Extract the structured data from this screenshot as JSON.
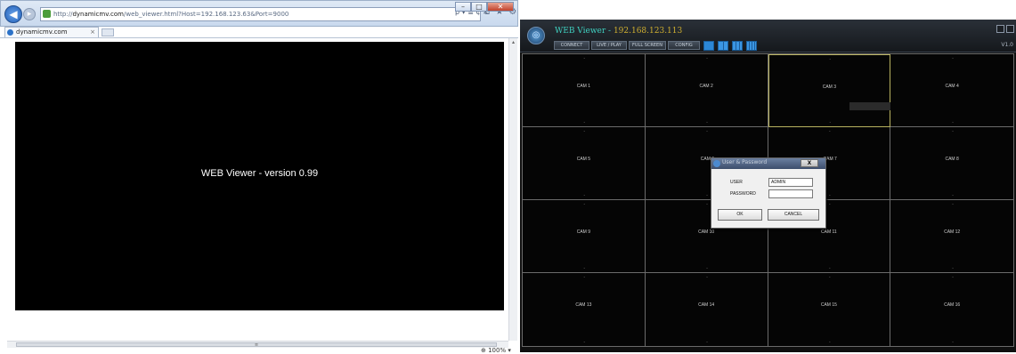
{
  "browser": {
    "url_prefix": "http://",
    "url_host": "dynamicmv.com",
    "url_path": "/web_viewer.html?Host=192.168.123.63&Port=9000",
    "addr_tools": "ρ ▾ ≣ ¢ ✕",
    "tab_title": "dynamicmv.com",
    "tab_close": "×",
    "back_icon": "◀",
    "fwd_icon": "▸",
    "nav_home": "⌂",
    "nav_favorites": "★",
    "nav_settings": "⚙",
    "version_text": "WEB Viewer - version 0.99",
    "zoom_level": "⊕ 100% ▾",
    "window_minimize": "–",
    "window_maximize": "□",
    "window_close": "✕",
    "scroll_up": "▴",
    "scroll_down": "▾",
    "hscroll_grip": "≡"
  },
  "viewer": {
    "title_prefix": "WEB Viewer - ",
    "title_ip": "192.168.123.113",
    "logo_glyph": "◎",
    "version": "V1.0",
    "toolbar": {
      "connect": "CONNECT",
      "live_play": "LIVE / PLAY",
      "full_screen": "FULL SCREEN",
      "config": "CONFIG"
    },
    "cameras": [
      "CAM 1",
      "CAM 2",
      "CAM 3",
      "CAM 4",
      "CAM 5",
      "CAM 6",
      "CAM 7",
      "CAM 8",
      "CAM 9",
      "CAM 10",
      "CAM 11",
      "CAM 12",
      "CAM 13",
      "CAM 14",
      "CAM 15",
      "CAM 16"
    ],
    "cam_dash": "-",
    "login": {
      "title": "User & Password",
      "close": "X",
      "user_label": "USER",
      "user_value": "ADMIN",
      "password_label": "PASSWORD",
      "password_value": "",
      "ok_label": "OK",
      "cancel_label": "CANCEL"
    }
  },
  "colors": {
    "viewer_title_prefix": "#3fd0c0",
    "viewer_title_ip": "#d0b030",
    "layout_buttons": "#2c87d6"
  }
}
